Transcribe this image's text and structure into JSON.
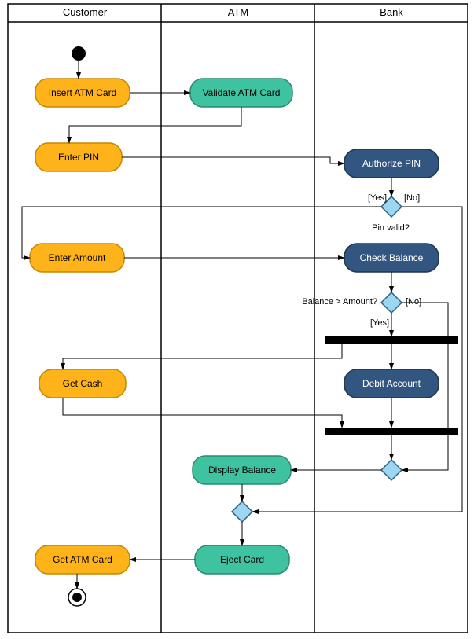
{
  "lanes": {
    "customer": "Customer",
    "atm": "ATM",
    "bank": "Bank"
  },
  "nodes": {
    "insert_card": "Insert ATM Card",
    "validate_card": "Validate ATM Card",
    "enter_pin": "Enter PIN",
    "authorize_pin": "Authorize PIN",
    "pin_valid_q": "Pin valid?",
    "enter_amount": "Enter Amount",
    "check_balance": "Check Balance",
    "balance_gt_q": "Balance > Amount?",
    "get_cash": "Get Cash",
    "debit_account": "Debit Account",
    "display_balance": "Display Balance",
    "eject_card": "Eject Card",
    "get_atm_card": "Get ATM Card"
  },
  "labels": {
    "yes": "[Yes]",
    "no": "[No]"
  },
  "chart_data": {
    "type": "uml_activity_diagram",
    "swimlanes": [
      "Customer",
      "ATM",
      "Bank"
    ],
    "activities": [
      {
        "id": "start",
        "type": "initial",
        "lane": "Customer"
      },
      {
        "id": "insert_card",
        "type": "action",
        "lane": "Customer",
        "label": "Insert ATM Card"
      },
      {
        "id": "validate_card",
        "type": "action",
        "lane": "ATM",
        "label": "Validate ATM Card"
      },
      {
        "id": "enter_pin",
        "type": "action",
        "lane": "Customer",
        "label": "Enter PIN"
      },
      {
        "id": "authorize_pin",
        "type": "action",
        "lane": "Bank",
        "label": "Authorize PIN"
      },
      {
        "id": "d_pin",
        "type": "decision",
        "lane": "Bank",
        "label": "Pin valid?"
      },
      {
        "id": "enter_amount",
        "type": "action",
        "lane": "Customer",
        "label": "Enter Amount"
      },
      {
        "id": "check_balance",
        "type": "action",
        "lane": "Bank",
        "label": "Check Balance"
      },
      {
        "id": "d_balance",
        "type": "decision",
        "lane": "Bank",
        "label": "Balance > Amount?"
      },
      {
        "id": "fork1",
        "type": "fork",
        "lane": "Bank"
      },
      {
        "id": "get_cash",
        "type": "action",
        "lane": "Customer",
        "label": "Get Cash"
      },
      {
        "id": "debit_account",
        "type": "action",
        "lane": "Bank",
        "label": "Debit Account"
      },
      {
        "id": "join1",
        "type": "join",
        "lane": "Bank"
      },
      {
        "id": "merge1",
        "type": "merge",
        "lane": "Bank"
      },
      {
        "id": "display_balance",
        "type": "action",
        "lane": "ATM",
        "label": "Display Balance"
      },
      {
        "id": "merge2",
        "type": "merge",
        "lane": "ATM"
      },
      {
        "id": "eject_card",
        "type": "action",
        "lane": "ATM",
        "label": "Eject Card"
      },
      {
        "id": "get_atm_card",
        "type": "action",
        "lane": "Customer",
        "label": "Get ATM Card"
      },
      {
        "id": "end",
        "type": "final",
        "lane": "Customer"
      }
    ],
    "transitions": [
      {
        "from": "start",
        "to": "insert_card"
      },
      {
        "from": "insert_card",
        "to": "validate_card"
      },
      {
        "from": "validate_card",
        "to": "enter_pin"
      },
      {
        "from": "enter_pin",
        "to": "authorize_pin"
      },
      {
        "from": "authorize_pin",
        "to": "d_pin"
      },
      {
        "from": "d_pin",
        "to": "enter_amount",
        "guard": "[Yes]"
      },
      {
        "from": "d_pin",
        "to": "merge2",
        "guard": "[No]"
      },
      {
        "from": "enter_amount",
        "to": "check_balance"
      },
      {
        "from": "check_balance",
        "to": "d_balance"
      },
      {
        "from": "d_balance",
        "to": "fork1",
        "guard": "[Yes]"
      },
      {
        "from": "d_balance",
        "to": "merge1",
        "guard": "[No]"
      },
      {
        "from": "fork1",
        "to": "get_cash"
      },
      {
        "from": "fork1",
        "to": "debit_account"
      },
      {
        "from": "get_cash",
        "to": "join1"
      },
      {
        "from": "debit_account",
        "to": "join1"
      },
      {
        "from": "join1",
        "to": "merge1"
      },
      {
        "from": "merge1",
        "to": "display_balance"
      },
      {
        "from": "display_balance",
        "to": "merge2"
      },
      {
        "from": "merge2",
        "to": "eject_card"
      },
      {
        "from": "eject_card",
        "to": "get_atm_card"
      },
      {
        "from": "get_atm_card",
        "to": "end"
      }
    ]
  }
}
